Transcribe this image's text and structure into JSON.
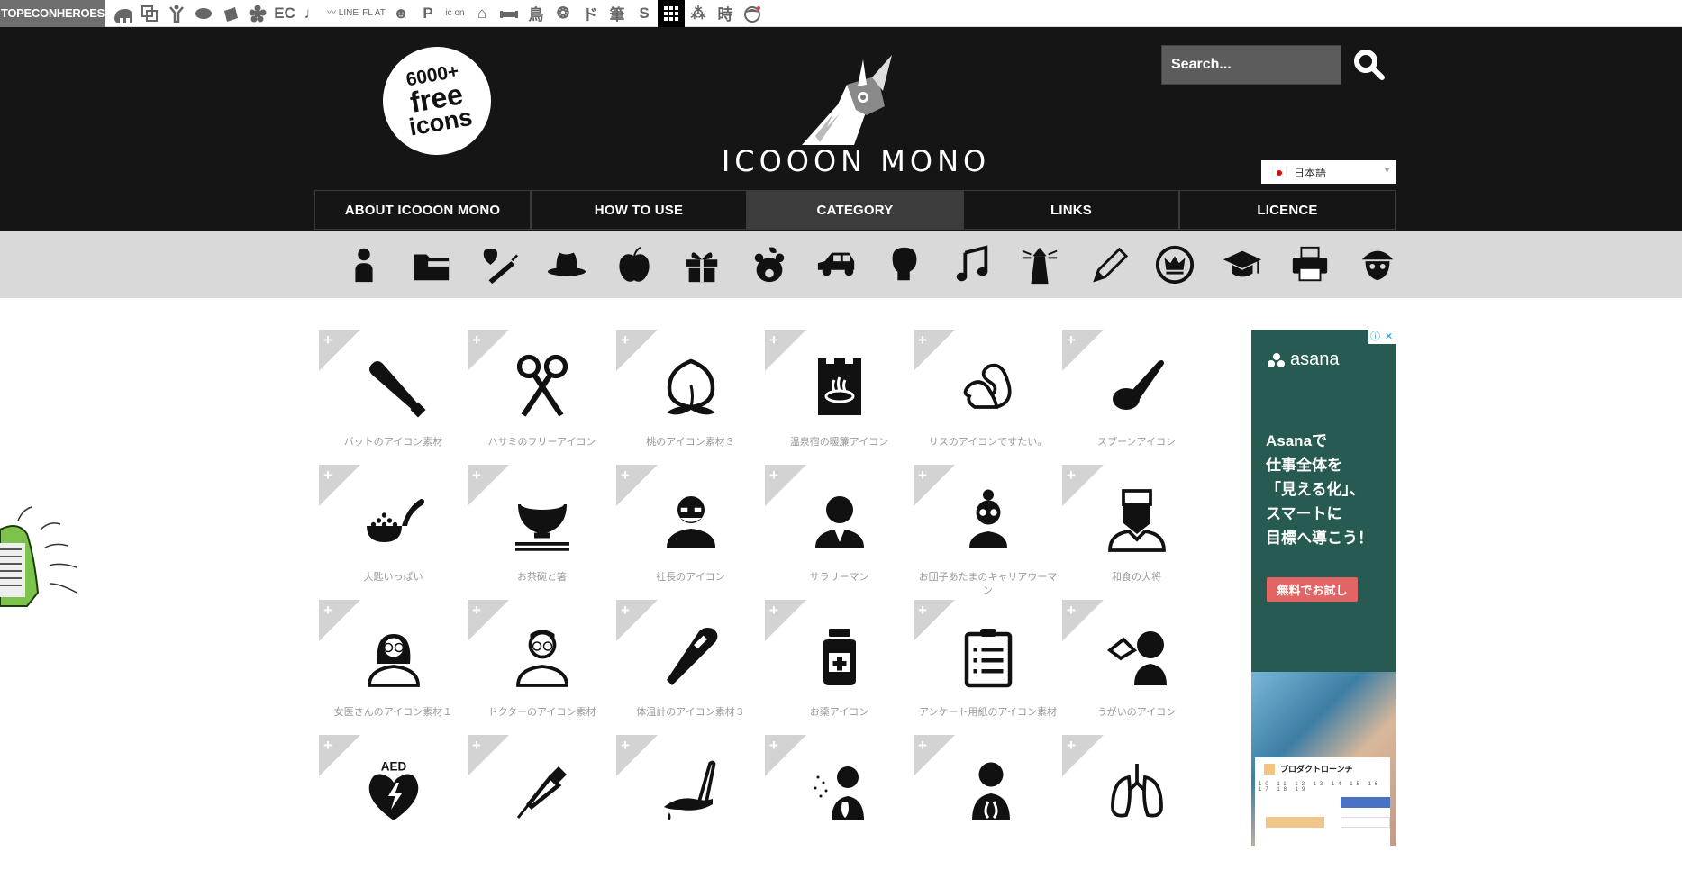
{
  "netbar": {
    "brand": "TOPECONHEROES",
    "sites": [
      {
        "name": "elephant-icon",
        "text": ""
      },
      {
        "name": "overlap-squares-icon",
        "text": ""
      },
      {
        "name": "dancer-icon",
        "text": ""
      },
      {
        "name": "speech-bubble-icon",
        "text": ""
      },
      {
        "name": "cards-icon",
        "text": ""
      },
      {
        "name": "flower-icon",
        "text": ""
      },
      {
        "name": "ec-site",
        "text": "EC"
      },
      {
        "name": "music-note-icon",
        "text": "♩"
      },
      {
        "name": "line-site",
        "text": "〰 LINE"
      },
      {
        "name": "flat-site",
        "text": "FL AT"
      },
      {
        "name": "smile-icon",
        "text": "☻"
      },
      {
        "name": "parking-site",
        "text": "P"
      },
      {
        "name": "icon-site",
        "text": "ic on"
      },
      {
        "name": "building-icon",
        "text": "⌂"
      },
      {
        "name": "sofa-icon",
        "text": ""
      },
      {
        "name": "bird-kanji-site",
        "text": "鳥"
      },
      {
        "name": "pattern-icon",
        "text": "❂"
      },
      {
        "name": "do-site",
        "text": "ド"
      },
      {
        "name": "brush-kanji-site",
        "text": "筆"
      },
      {
        "name": "s-site",
        "text": "S"
      },
      {
        "name": "grid-site",
        "text": ""
      },
      {
        "name": "sunburst-icon",
        "text": "⁂"
      },
      {
        "name": "time-kanji-site",
        "text": "時"
      },
      {
        "name": "girl-face-icon",
        "text": ""
      }
    ]
  },
  "header": {
    "badge": [
      "6000+",
      "free",
      "icons"
    ],
    "title": "ICOOON MONO",
    "search_placeholder": "Search...",
    "language": "日本語"
  },
  "nav": [
    {
      "label": "ABOUT ICOOON MONO",
      "active": false
    },
    {
      "label": "HOW TO USE",
      "active": false
    },
    {
      "label": "CATEGORY",
      "active": true
    },
    {
      "label": "LINKS",
      "active": false
    },
    {
      "label": "LICENCE",
      "active": false
    }
  ],
  "categories": [
    "person",
    "folder",
    "medical-heart-syringe",
    "hat",
    "apple",
    "gift",
    "bear",
    "car",
    "boxing-glove",
    "music",
    "lighthouse",
    "pencil",
    "crown",
    "graduation-cap",
    "printer",
    "pirate-skull"
  ],
  "icons": [
    {
      "icon": "baseball-bat",
      "label": "バットのアイコン素材"
    },
    {
      "icon": "scissors",
      "label": "ハサミのフリーアイコン"
    },
    {
      "icon": "peach",
      "label": "桃のアイコン素材３"
    },
    {
      "icon": "onsen-sign",
      "label": "温泉宿の暖簾アイコン"
    },
    {
      "icon": "squirrel",
      "label": "リスのアイコンですたい。"
    },
    {
      "icon": "spoon",
      "label": "スプーンアイコン"
    },
    {
      "icon": "ladle-rice",
      "label": "大匙いっぱい"
    },
    {
      "icon": "rice-bowl-chopsticks",
      "label": "お茶碗と箸"
    },
    {
      "icon": "company-president",
      "label": "社長のアイコン"
    },
    {
      "icon": "salaryman",
      "label": "サラリーマン"
    },
    {
      "icon": "career-woman",
      "label": "お団子あたまのキャリアウーマン"
    },
    {
      "icon": "japanese-chef",
      "label": "和食の大将"
    },
    {
      "icon": "female-doctor",
      "label": "女医さんのアイコン素材１"
    },
    {
      "icon": "doctor",
      "label": "ドクターのアイコン素材"
    },
    {
      "icon": "thermometer",
      "label": "体温計のアイコン素材３"
    },
    {
      "icon": "medicine-bottle",
      "label": "お薬アイコン"
    },
    {
      "icon": "clipboard",
      "label": "アンケート用紙のアイコン素材"
    },
    {
      "icon": "gargle",
      "label": "うがいのアイコン"
    },
    {
      "icon": "aed-heart",
      "label": ""
    },
    {
      "icon": "syringe",
      "label": ""
    },
    {
      "icon": "scalpel-cut",
      "label": ""
    },
    {
      "icon": "cough-spray",
      "label": ""
    },
    {
      "icon": "airway",
      "label": ""
    },
    {
      "icon": "lungs",
      "label": ""
    }
  ],
  "tile_add_symbol": "+",
  "ad": {
    "brand": "asana",
    "info_icon": "ⓘ",
    "close_icon": "✕",
    "copy": [
      "Asanaで",
      "仕事全体を",
      "「見える化」、",
      "スマートに",
      "目標へ導こう！"
    ],
    "cta": "無料でお試し",
    "card_title": "プロダクトローンチ",
    "card_days": "10 11 12 13 14 15 16 17 18 19"
  },
  "colors": {
    "header_bg": "#151515",
    "category_bar_bg": "#d9d9d9",
    "ad_bg": "#275b51",
    "ad_cta": "#e36464"
  }
}
